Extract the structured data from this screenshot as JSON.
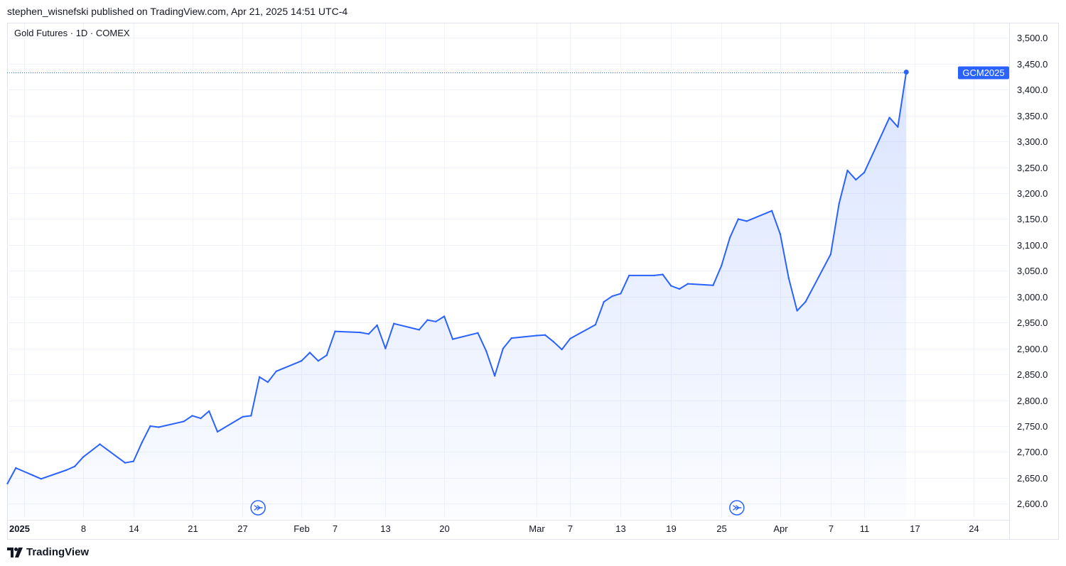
{
  "header": {
    "publisher_line": "stephen_wisnefski published on TradingView.com, Apr 21, 2025 14:51 UTC-4"
  },
  "legend": {
    "title": "Gold Futures · 1D · COMEX"
  },
  "footer": {
    "brand": "TradingView",
    "logo_icon": "tradingview-logo-icon"
  },
  "colors": {
    "line": "#2962ff",
    "grid": "#f0f3fa",
    "text": "#131722",
    "label_bg": "#2962ff"
  },
  "chart_data": {
    "type": "area",
    "title": "Gold Futures · 1D · COMEX",
    "xlabel": "",
    "ylabel": "",
    "ylim": [
      2573,
      3528
    ],
    "grid": true,
    "y_ticks": [
      2600,
      2650,
      2700,
      2750,
      2800,
      2850,
      2900,
      2950,
      3000,
      3050,
      3100,
      3150,
      3200,
      3250,
      3300,
      3350,
      3400,
      3450,
      3500
    ],
    "y_tick_labels": [
      "2,600.0",
      "2,650.0",
      "2,700.0",
      "2,750.0",
      "2,800.0",
      "2,850.0",
      "2,900.0",
      "2,950.0",
      "3,000.0",
      "3,050.0",
      "3,100.0",
      "3,150.0",
      "3,200.0",
      "3,250.0",
      "3,300.0",
      "3,350.0",
      "3,400.0",
      "3,450.0",
      "3,500.0"
    ],
    "x_ticks": [
      {
        "date": "2025-01-01",
        "label": "2025",
        "bold": true
      },
      {
        "date": "2025-01-08",
        "label": "8"
      },
      {
        "date": "2025-01-14",
        "label": "14"
      },
      {
        "date": "2025-01-21",
        "label": "21"
      },
      {
        "date": "2025-01-27",
        "label": "27"
      },
      {
        "date": "2025-02-03",
        "label": "Feb"
      },
      {
        "date": "2025-02-07",
        "label": "7"
      },
      {
        "date": "2025-02-13",
        "label": "13"
      },
      {
        "date": "2025-02-20",
        "label": "20"
      },
      {
        "date": "2025-03-03",
        "label": "Mar"
      },
      {
        "date": "2025-03-07",
        "label": "7"
      },
      {
        "date": "2025-03-13",
        "label": "13"
      },
      {
        "date": "2025-03-19",
        "label": "19"
      },
      {
        "date": "2025-03-25",
        "label": "25"
      },
      {
        "date": "2025-04-01",
        "label": "Apr"
      },
      {
        "date": "2025-04-07",
        "label": "7"
      },
      {
        "date": "2025-04-11",
        "label": "11"
      },
      {
        "date": "2025-04-17",
        "label": "17"
      },
      {
        "date": "2025-04-24",
        "label": "24"
      }
    ],
    "series": [
      {
        "name": "GCM2025",
        "points": [
          [
            "2024-12-30",
            2639
          ],
          [
            "2024-12-31",
            2669
          ],
          [
            "2025-01-02",
            2655
          ],
          [
            "2025-01-03",
            2648
          ],
          [
            "2025-01-06",
            2665
          ],
          [
            "2025-01-07",
            2672
          ],
          [
            "2025-01-08",
            2690
          ],
          [
            "2025-01-10",
            2715
          ],
          [
            "2025-01-13",
            2679
          ],
          [
            "2025-01-14",
            2682
          ],
          [
            "2025-01-15",
            2718
          ],
          [
            "2025-01-16",
            2750
          ],
          [
            "2025-01-17",
            2748
          ],
          [
            "2025-01-20",
            2759
          ],
          [
            "2025-01-21",
            2770
          ],
          [
            "2025-01-22",
            2765
          ],
          [
            "2025-01-23",
            2779
          ],
          [
            "2025-01-24",
            2739
          ],
          [
            "2025-01-27",
            2768
          ],
          [
            "2025-01-28",
            2770
          ],
          [
            "2025-01-29",
            2845
          ],
          [
            "2025-01-30",
            2835
          ],
          [
            "2025-01-31",
            2856
          ],
          [
            "2025-02-03",
            2876
          ],
          [
            "2025-02-04",
            2892
          ],
          [
            "2025-02-05",
            2876
          ],
          [
            "2025-02-06",
            2887
          ],
          [
            "2025-02-07",
            2933
          ],
          [
            "2025-02-10",
            2931
          ],
          [
            "2025-02-11",
            2928
          ],
          [
            "2025-02-12",
            2945
          ],
          [
            "2025-02-13",
            2900
          ],
          [
            "2025-02-14",
            2948
          ],
          [
            "2025-02-17",
            2936
          ],
          [
            "2025-02-18",
            2955
          ],
          [
            "2025-02-19",
            2952
          ],
          [
            "2025-02-20",
            2962
          ],
          [
            "2025-02-21",
            2918
          ],
          [
            "2025-02-24",
            2930
          ],
          [
            "2025-02-25",
            2895
          ],
          [
            "2025-02-26",
            2847
          ],
          [
            "2025-02-27",
            2900
          ],
          [
            "2025-02-28",
            2920
          ],
          [
            "2025-03-03",
            2925
          ],
          [
            "2025-03-04",
            2926
          ],
          [
            "2025-03-05",
            2913
          ],
          [
            "2025-03-06",
            2898
          ],
          [
            "2025-03-07",
            2919
          ],
          [
            "2025-03-10",
            2946
          ],
          [
            "2025-03-11",
            2990
          ],
          [
            "2025-03-12",
            3001
          ],
          [
            "2025-03-13",
            3006
          ],
          [
            "2025-03-14",
            3041
          ],
          [
            "2025-03-17",
            3041
          ],
          [
            "2025-03-18",
            3043
          ],
          [
            "2025-03-19",
            3021
          ],
          [
            "2025-03-20",
            3015
          ],
          [
            "2025-03-21",
            3025
          ],
          [
            "2025-03-24",
            3022
          ],
          [
            "2025-03-25",
            3060
          ],
          [
            "2025-03-26",
            3114
          ],
          [
            "2025-03-27",
            3150
          ],
          [
            "2025-03-28",
            3146
          ],
          [
            "2025-03-31",
            3166
          ],
          [
            "2025-04-01",
            3121
          ],
          [
            "2025-04-02",
            3036
          ],
          [
            "2025-04-03",
            2973
          ],
          [
            "2025-04-04",
            2990
          ],
          [
            "2025-04-07",
            3082
          ],
          [
            "2025-04-08",
            3180
          ],
          [
            "2025-04-09",
            3244
          ],
          [
            "2025-04-10",
            3226
          ],
          [
            "2025-04-11",
            3240
          ],
          [
            "2025-04-14",
            3346
          ],
          [
            "2025-04-15",
            3328
          ],
          [
            "2025-04-16",
            3434
          ]
        ]
      }
    ],
    "last_value_label": "GCM2025",
    "event_markers": [
      {
        "date": "2025-01-29",
        "icon": "event-arrow-icon"
      },
      {
        "date": "2025-03-27",
        "icon": "event-arrow-icon"
      }
    ]
  }
}
